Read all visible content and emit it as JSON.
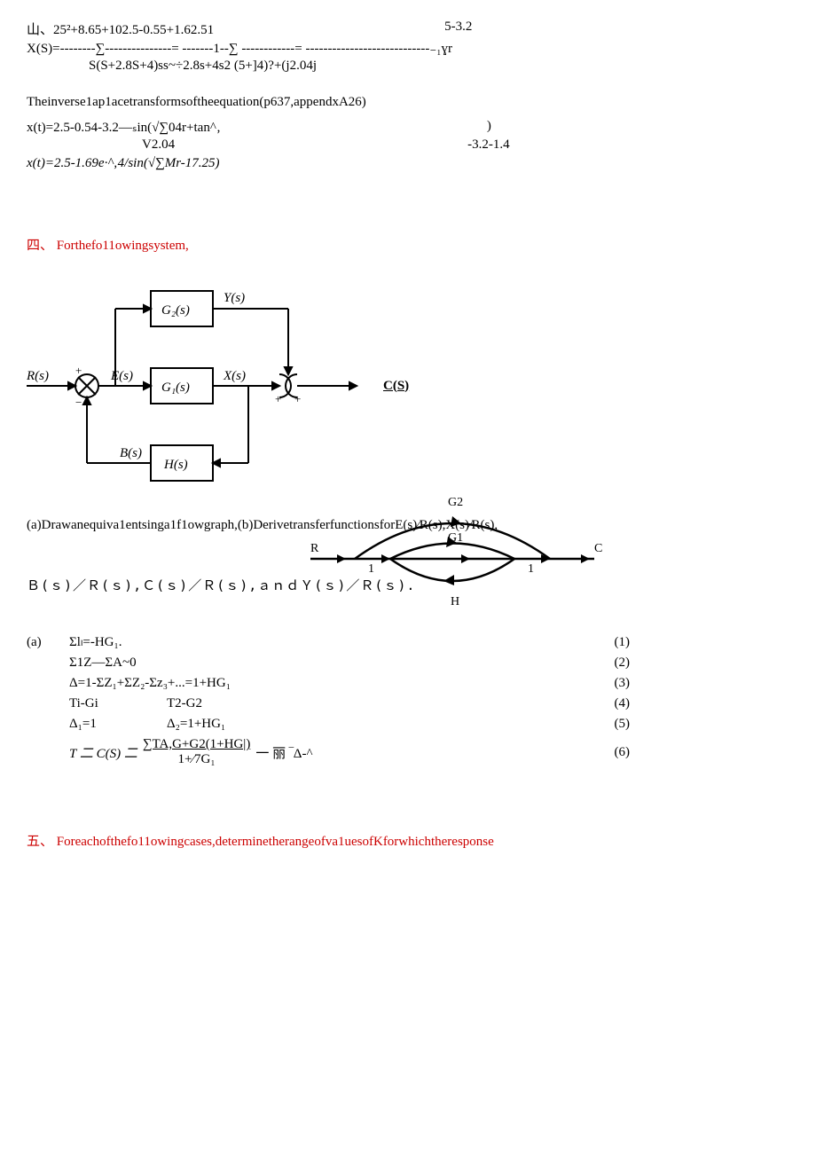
{
  "top": {
    "l1_left": "山、25²+8.65+102.5-0.55+1.62.51",
    "l1_right": "5-3.2",
    "l2": "X(S)=--------∑---------------= -------1--∑ ------------= ----------------------------₋₁ɣr",
    "l3": "S(S+2.8S+4)ss~÷2.8s+4s2 (5+]4)?+(j2.04j",
    "l4": "Theinverse1ap1acetransformsoftheequation(p637,appendxA26)",
    "l5_left": "x(t)=2.5-0.54-3.2—ₛin(√∑04r+tan^‚",
    "l5_paren": ")",
    "l6_left": "V2.04",
    "l6_right": "-3.2-1.4",
    "l7": "x(t)=2.5-1.69e·^‚4/sin(√∑Mr-17.25)"
  },
  "sec4": {
    "heading_cjk": "四、",
    "heading": "Forthefo11owingsystem,",
    "diag": {
      "R": "R(s)",
      "E": "E(s)",
      "X": "X(s)",
      "Y": "Y(s)",
      "B": "B(s)",
      "G1": "G₁(s)",
      "G2": "G₂(s)",
      "H": "H(s)",
      "C": "C(S)",
      "plus1": "+",
      "plus2": "+",
      "plus3": "+",
      "minus": "−"
    },
    "q": "(a)Drawanequiva1entsinga1f1owgraph,(b)DerivetransferfunctionsforE(s)⁄R(s),X(s)⁄R(s),",
    "sfg": {
      "R": "R",
      "C": "C",
      "G1": "G1",
      "G2": "G2",
      "H": "H",
      "one": "1"
    },
    "brc": "Ｂ(ｓ)／Ｒ(ｓ),Ｃ(ｓ)／Ｒ(ｓ),ａｎｄＹ(ｓ)／Ｒ(ｓ).",
    "eqs": {
      "a": "(a)",
      "e1": "Σlₗ=-HG₁.",
      "n1": "(1)",
      "e2": "Σ1Z—ΣA~0",
      "n2": "(2)",
      "e3": "Δ=1-ΣZ₁+ΣZ₂-Σz₃+...=1+HG₁",
      "n3": "(3)",
      "e4a": "Ti-Gi",
      "e4b": "T2-G2",
      "n4": "(4)",
      "e5a": "Δ₁=1",
      "e5b": "Δ₂=1+HG₁",
      "n5": "(5)",
      "e6": "T 二 C(S) 二",
      "e6u": "∑TA,G+G2(1+HG|)",
      "e6mid": " 一 丽 ­‾Δ-^",
      "e6d": "1+⁄7G₁",
      "n6": "(6)"
    }
  },
  "sec5": {
    "heading_cjk": "五、",
    "heading": "Foreachofthefo11owingcases,determinetherangeofva1uesofKforwhichtheresponse"
  }
}
